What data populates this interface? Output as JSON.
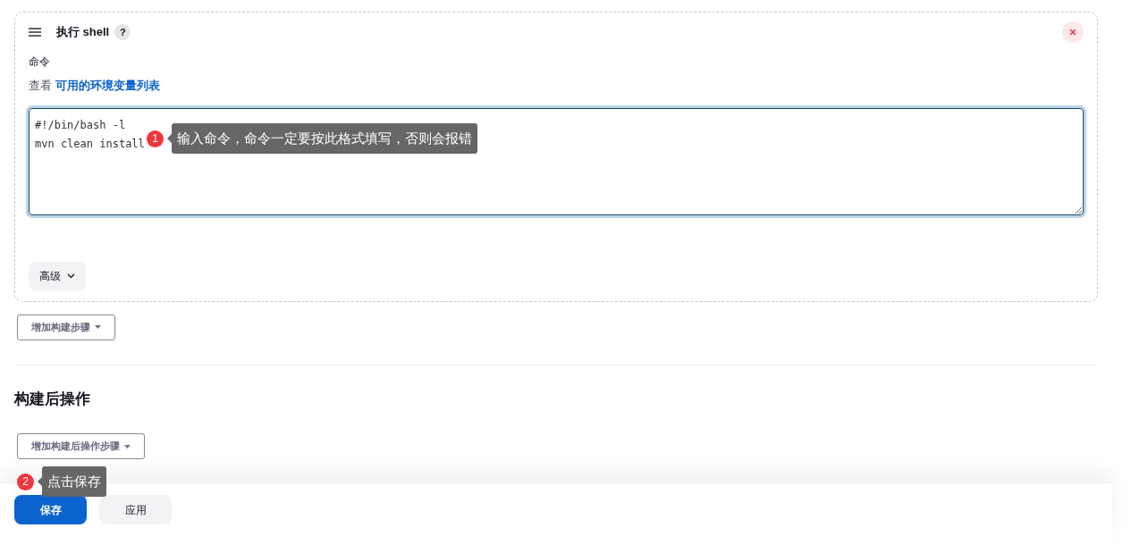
{
  "build_step": {
    "title": "执行 shell",
    "help": "?",
    "field_label": "命令",
    "env_hint": {
      "prefix": "查看",
      "link": "可用的环境变量列表"
    },
    "command": "#!/bin/bash -l\nmvn clean install",
    "advanced": "高级"
  },
  "add_build_step": "增加构建步骤",
  "post_build": {
    "title": "构建后操作",
    "add_step": "增加构建后操作步骤"
  },
  "annotations": [
    {
      "number": "1",
      "text": "输入命令，命令一定要按此格式填写，否则会报错"
    },
    {
      "number": "2",
      "text": "点击保存"
    }
  ],
  "buttons": [
    {
      "label": "保存",
      "kind": "primary"
    },
    {
      "label": "应用",
      "kind": "secondary"
    }
  ]
}
